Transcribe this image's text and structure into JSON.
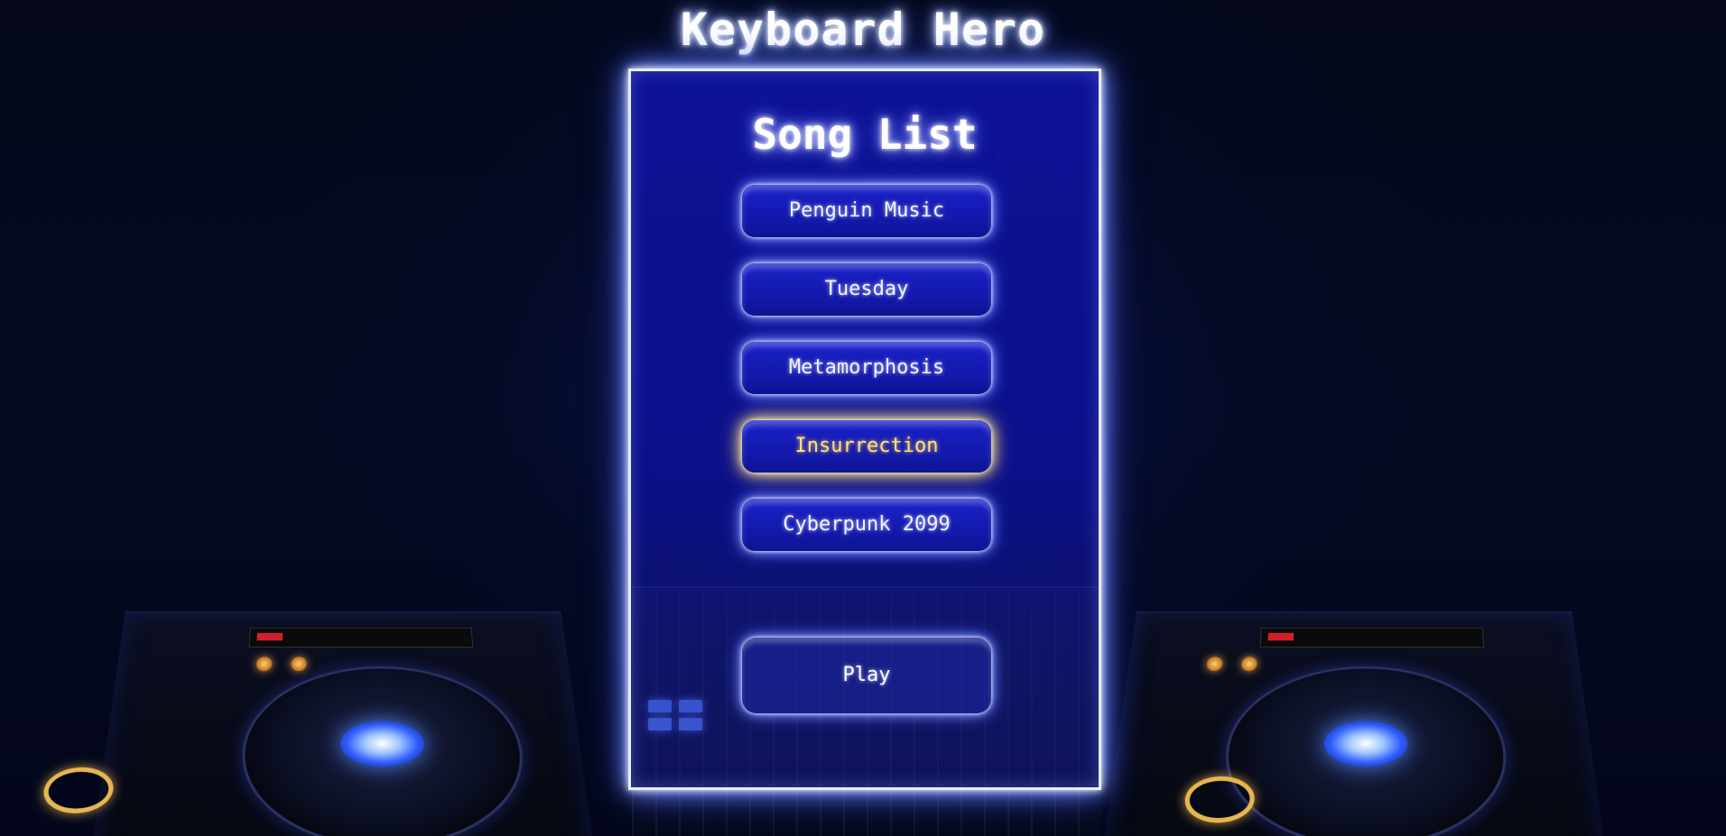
{
  "game": {
    "title": "Keyboard Hero"
  },
  "song_list": {
    "heading": "Song List",
    "songs": [
      {
        "name": "Penguin Music",
        "selected": false
      },
      {
        "name": "Tuesday",
        "selected": false
      },
      {
        "name": "Metamorphosis",
        "selected": false
      },
      {
        "name": "Insurrection",
        "selected": true
      },
      {
        "name": "Cyberpunk 2099",
        "selected": false
      }
    ],
    "selected_song": "Insurrection"
  },
  "play_button": {
    "label": "Play"
  },
  "colors": {
    "panel_blue": "#0e1296",
    "glow": "#8fa6ff",
    "selected_text": "#ffe27a"
  }
}
